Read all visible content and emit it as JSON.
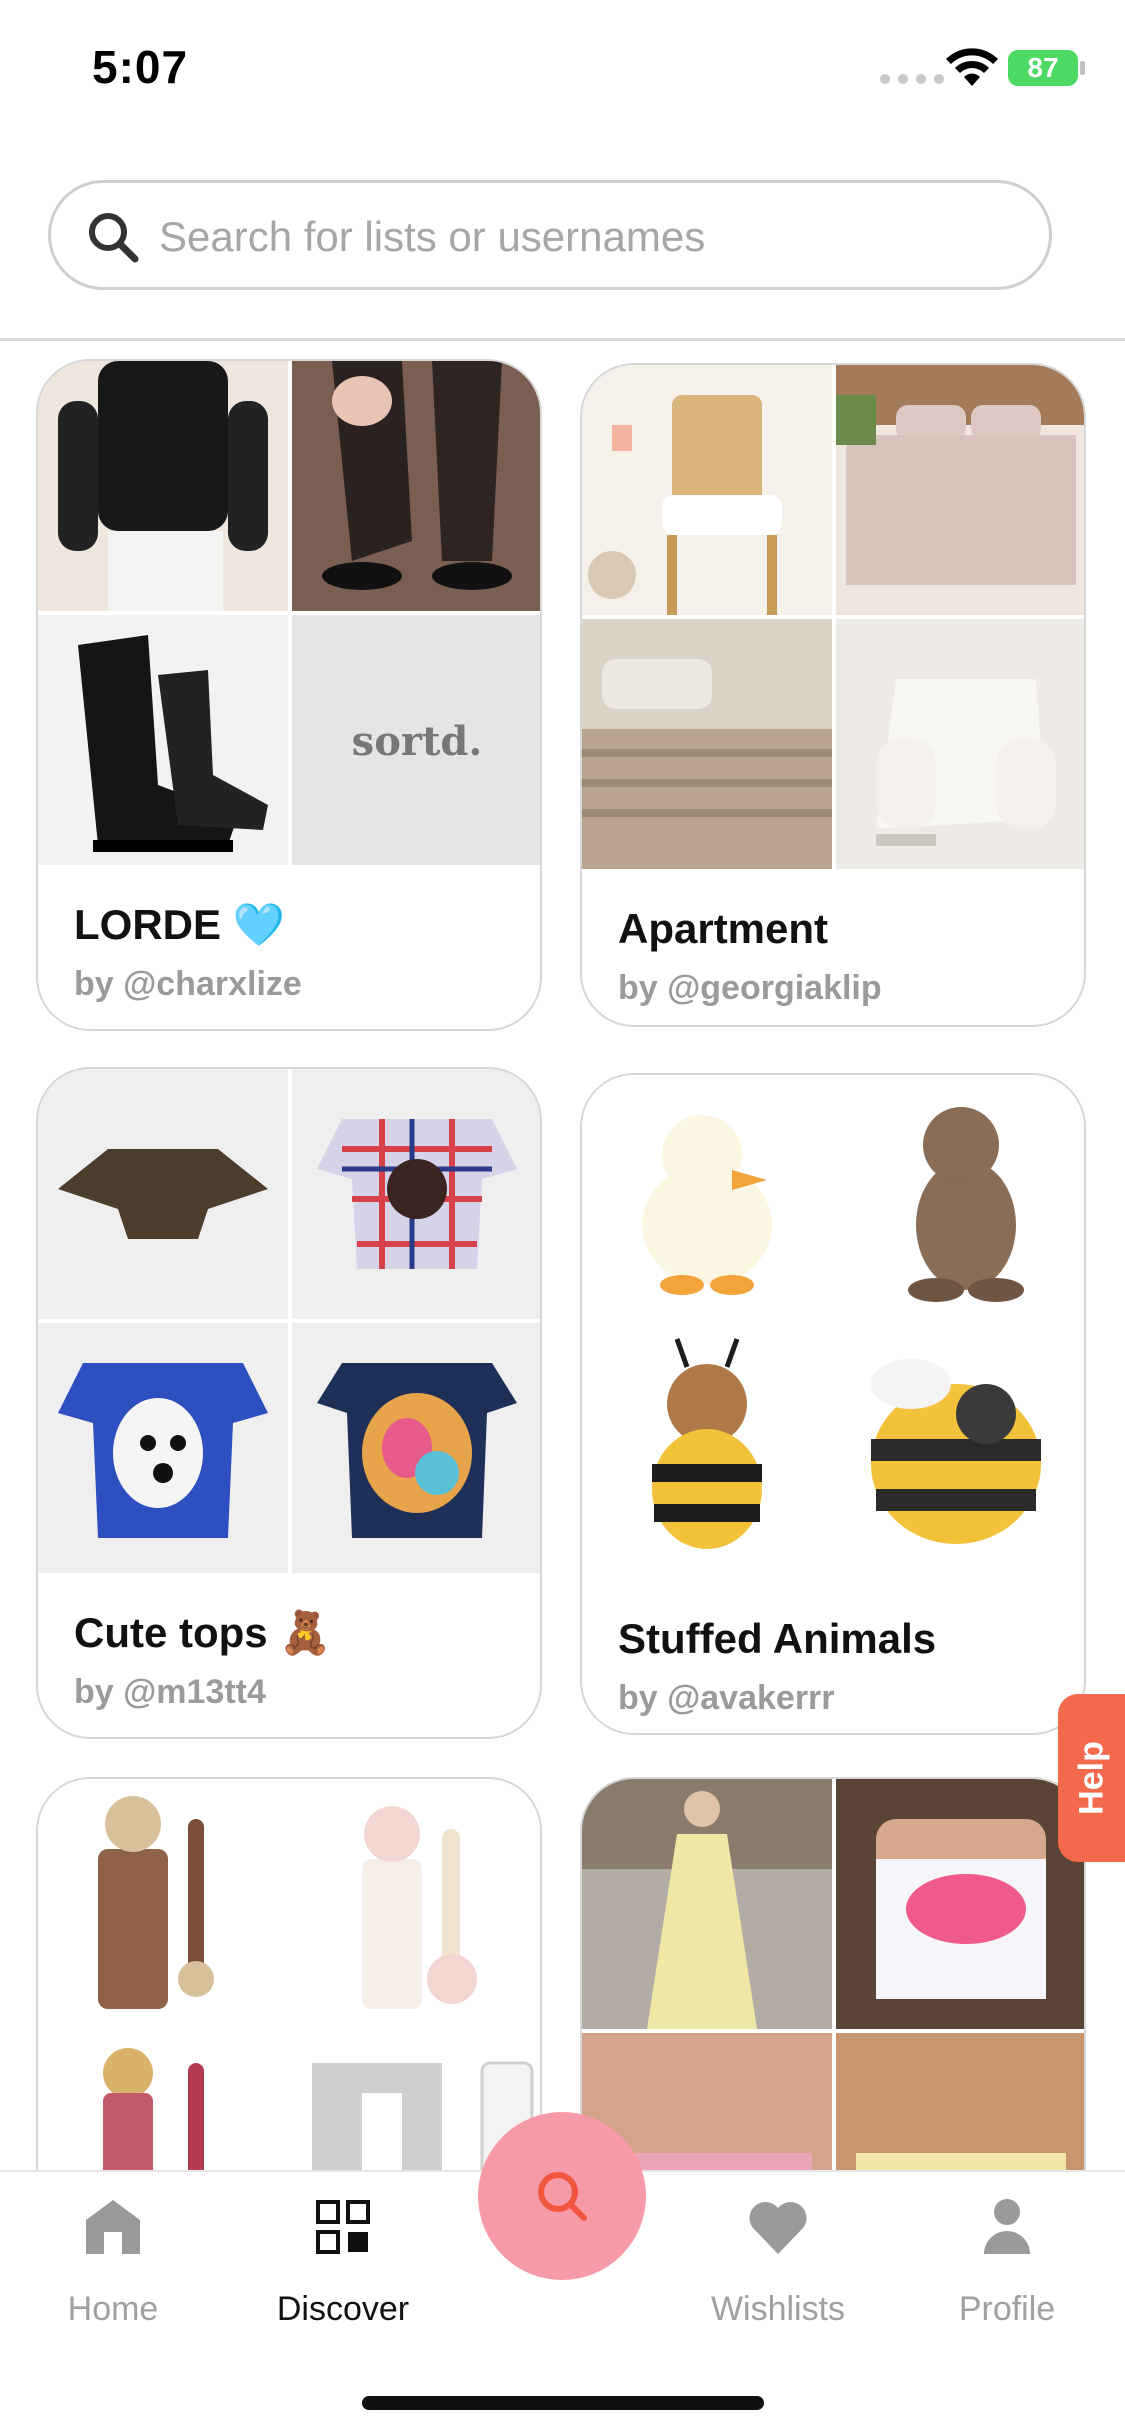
{
  "status_bar": {
    "time": "5:07",
    "battery": "87"
  },
  "search": {
    "placeholder": "Search for lists or usernames"
  },
  "lists": [
    {
      "title": "LORDE 🩵",
      "author": "by @charxlize",
      "placeholder_text": "sortd."
    },
    {
      "title": "Apartment",
      "author": "by @georgiaklip"
    },
    {
      "title": "Cute tops 🧸",
      "author": "by @m13tt4"
    },
    {
      "title": "Stuffed Animals",
      "author": "by @avakerrr"
    },
    {
      "title": "",
      "author": ""
    },
    {
      "title": "",
      "author": ""
    }
  ],
  "help": {
    "label": "Help"
  },
  "nav": {
    "home": "Home",
    "discover": "Discover",
    "wishlists": "Wishlists",
    "profile": "Profile"
  },
  "colors": {
    "accent": "#f26a4b",
    "fab": "#f79aa8",
    "battery": "#4cd964",
    "muted_text": "#9a9a9a"
  },
  "icons": {
    "search": "search-icon",
    "home": "home-icon",
    "discover": "grid-icon",
    "wishlists": "heart-icon",
    "profile": "person-icon"
  }
}
